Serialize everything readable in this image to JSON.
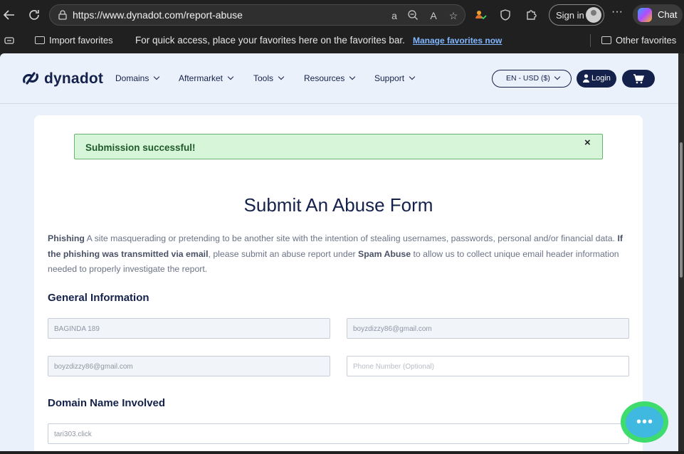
{
  "browser": {
    "url": "https://www.dynadot.com/report-abuse",
    "sign_in_label": "Sign in",
    "chat_label": "Chat",
    "favbar": {
      "import_label": "Import favorites",
      "quick_access_text": "For quick access, place your favorites here on the favorites bar.",
      "manage_link": "Manage favorites now",
      "other_favorites": "Other favorites"
    }
  },
  "site": {
    "logo_text": "dynadot",
    "nav": [
      "Domains",
      "Aftermarket",
      "Tools",
      "Resources",
      "Support"
    ],
    "currency_label": "EN - USD ($)",
    "login_label": "Login"
  },
  "alert": {
    "message": "Submission successful!",
    "close_glyph": "×"
  },
  "form": {
    "title": "Submit An Abuse Form",
    "description": {
      "b1": "Phishing",
      "t1": " A site masquerading or pretending to be another site with the intention of stealing usernames, passwords, personal and/or financial data. ",
      "b2": "If the phishing was transmitted via email",
      "t2": ", please submit an abuse report under ",
      "b3": "Spam Abuse",
      "t3": " to allow us to collect unique email header information needed to properly investigate the report."
    },
    "general_heading": "General Information",
    "fields": {
      "name": "BAGINDA 189",
      "email": "boyzdizzy86@gmail.com",
      "confirm_email": "boyzdizzy86@gmail.com",
      "phone_placeholder": "Phone Number (Optional)"
    },
    "domain_heading": "Domain Name Involved",
    "domain_value": "tari303.click"
  },
  "colors": {
    "navy": "#14214a",
    "alert_bg": "#d7f6d9",
    "alert_border": "#68b36f",
    "page_bg": "#eaf1fb"
  }
}
